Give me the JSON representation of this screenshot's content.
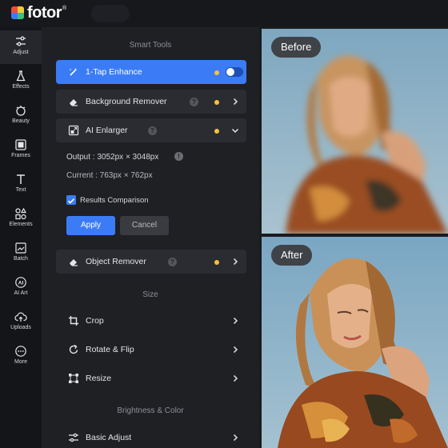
{
  "app": {
    "brand": "fotor",
    "registered": "®"
  },
  "rail": [
    {
      "label": "Adjust",
      "icon": "sliders-icon",
      "active": true
    },
    {
      "label": "Effects",
      "icon": "flask-icon"
    },
    {
      "label": "Beauty",
      "icon": "face-icon"
    },
    {
      "label": "Frames",
      "icon": "frame-icon"
    },
    {
      "label": "Text",
      "icon": "text-icon"
    },
    {
      "label": "Elements",
      "icon": "shapes-icon"
    },
    {
      "label": "Batch",
      "icon": "batch-icon"
    },
    {
      "label": "AI Art",
      "icon": "ai-icon"
    },
    {
      "label": "Uploads",
      "icon": "upload-icon"
    },
    {
      "label": "More",
      "icon": "more-icon"
    }
  ],
  "panel": {
    "smart_tools_title": "Smart Tools",
    "tap_enhance": {
      "label": "1-Tap Enhance",
      "enabled": true
    },
    "background_remover": {
      "label": "Background Remover",
      "help": "?"
    },
    "ai_enlarger": {
      "label": "AI Enlarger",
      "help": "?",
      "expanded": true,
      "output": "Output : 3052px × 3048px",
      "info": "!",
      "current": "Current : 763px × 762px",
      "results_comparison": "Results Comparison",
      "apply": "Apply",
      "cancel": "Cancel"
    },
    "object_remover": {
      "label": "Object Remover",
      "help": "?"
    },
    "size_title": "Size",
    "size_tools": [
      "Crop",
      "Rotate & Flip",
      "Resize"
    ],
    "brightness_title": "Brightness & Color",
    "basic_adjust": "Basic Adjust"
  },
  "preview": {
    "before_label": "Before",
    "after_label": "After"
  },
  "colors": {
    "accent": "#3b7cf6",
    "pro_dot": "#f5c13b",
    "panel_bg": "#1f2024",
    "item_bg": "#2b2c31"
  }
}
